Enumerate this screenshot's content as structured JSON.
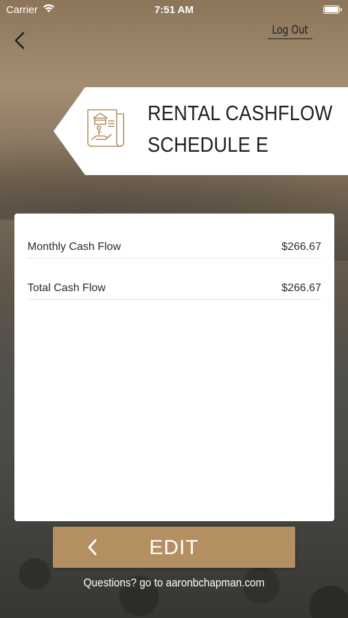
{
  "status_bar": {
    "carrier": "Carrier",
    "time": "7:51 AM"
  },
  "header": {
    "logout_label": "Log Out"
  },
  "banner": {
    "title_line1": "RENTAL CASHFLOW",
    "title_line2": "SCHEDULE E",
    "icon": "rental-document-icon"
  },
  "results": [
    {
      "label": "Monthly Cash Flow",
      "value": "$266.67"
    },
    {
      "label": "Total Cash Flow",
      "value": "$266.67"
    }
  ],
  "edit_button": {
    "label": "EDIT"
  },
  "footer": {
    "text": "Questions? go to aaronbchapman.com"
  },
  "colors": {
    "accent": "#b48f62",
    "card": "#ffffff",
    "text": "#2a2a2a"
  }
}
